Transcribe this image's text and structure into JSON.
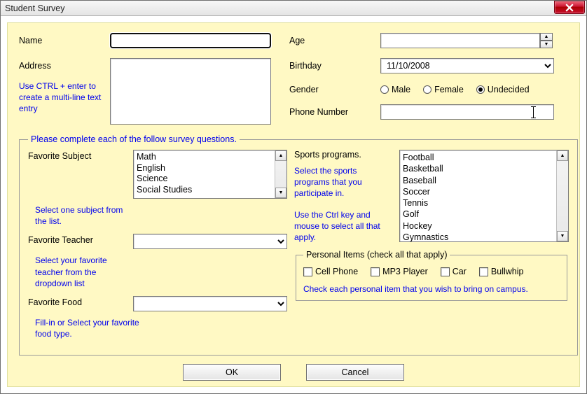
{
  "window": {
    "title": "Student Survey",
    "close_label": "Close"
  },
  "fields": {
    "name_label": "Name",
    "address_label": "Address",
    "address_hint": "Use CTRL + enter to create a multi-line text entry",
    "age_label": "Age",
    "birthday_label": "Birthday",
    "birthday_value": "11/10/2008",
    "gender_label": "Gender",
    "gender_options": {
      "male": "Male",
      "female": "Female",
      "undecided": "Undecided"
    },
    "gender_selected": "undecided",
    "phone_label": "Phone Number"
  },
  "survey": {
    "legend": "Please complete each of the follow survey questions.",
    "subject_label": "Favorite Subject",
    "subject_hint": "Select one subject from the list.",
    "subject_items": [
      "Math",
      "English",
      "Science",
      "Social Studies"
    ],
    "teacher_label": "Favorite Teacher",
    "teacher_hint": "Select your favorite teacher from the dropdown list",
    "food_label": "Favorite Food",
    "food_hint": "Fill-in or Select your favorite food type.",
    "sports_label": "Sports programs.",
    "sports_hint1": "Select the sports programs that you participate in.",
    "sports_hint2": "Use the Ctrl key and mouse to select all that apply.",
    "sports_items": [
      "Football",
      "Basketball",
      "Baseball",
      "Soccer",
      "Tennis",
      "Golf",
      "Hockey",
      "Gymnastics"
    ]
  },
  "personal": {
    "legend": "Personal Items (check all that apply)",
    "items": {
      "cell": "Cell Phone",
      "mp3": "MP3 Player",
      "car": "Car",
      "bullwhip": "Bullwhip"
    },
    "hint": "Check each personal item that you wish to bring on campus."
  },
  "buttons": {
    "ok": "OK",
    "cancel": "Cancel"
  }
}
